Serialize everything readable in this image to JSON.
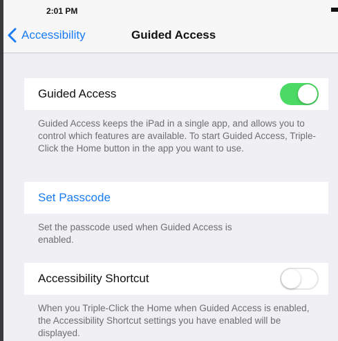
{
  "status_bar": {
    "time": "2:01 PM"
  },
  "nav": {
    "back_label": "Accessibility",
    "title": "Guided Access"
  },
  "guided_access": {
    "label": "Guided Access",
    "enabled": true,
    "footer": "Guided Access keeps the iPad in a single app, and allows you to control which features are available. To start Guided Access, Triple-Click the Home button in the app you want to use."
  },
  "passcode": {
    "label": "Set Passcode",
    "footer": "Set the passcode used when Guided Access is enabled."
  },
  "accessibility_shortcut": {
    "label": "Accessibility Shortcut",
    "enabled": false,
    "footer": "When you Triple-Click the Home when Guided Access is enabled, the Accessibility Shortcut settings you have enabled will be displayed."
  },
  "colors": {
    "accent": "#1a7cf5",
    "toggle_on": "#4cd964",
    "background": "#efeff4"
  }
}
